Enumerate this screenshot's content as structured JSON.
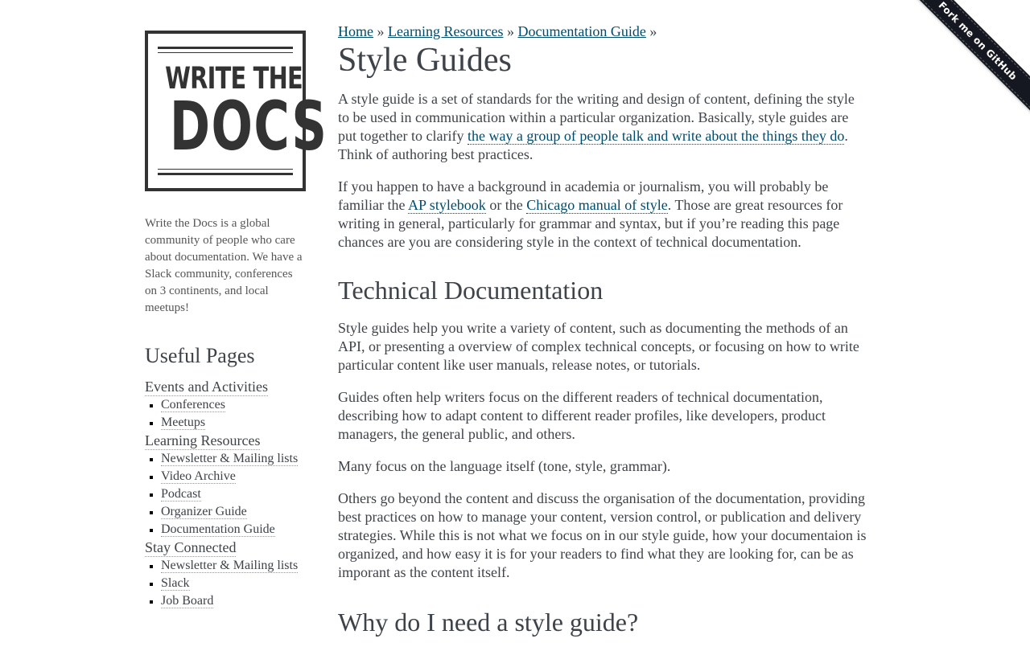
{
  "logo": {
    "line1": "WRITE THE",
    "line2": "DOCS"
  },
  "sidebar": {
    "blurb": "Write the Docs is a global community of people who care about documentation. We have a Slack community, conferences on 3 continents, and local meetups!",
    "useful_title": "Useful Pages",
    "sections": [
      {
        "label": "Events and Activities",
        "items": [
          "Conferences",
          "Meetups"
        ]
      },
      {
        "label": "Learning Resources",
        "items": [
          "Newsletter & Mailing lists",
          "Video Archive",
          "Podcast",
          "Organizer Guide",
          "Documentation Guide"
        ]
      },
      {
        "label": "Stay Connected",
        "items": [
          "Newsletter & Mailing lists",
          "Slack",
          "Job Board"
        ]
      }
    ]
  },
  "breadcrumb": {
    "items": [
      "Home",
      "Learning Resources",
      "Documentation Guide"
    ],
    "separator": "»"
  },
  "main": {
    "title": "Style Guides",
    "intro": {
      "p1_before": "A style guide is a set of standards for the writing and design of content, defining the style to be used in communication within a particular organization. Basically, style guides are put together to clarify ",
      "p1_link": "the way a group of people talk and write about the things they do",
      "p1_after": ". Think of authoring best practices.",
      "p2_before": "If you happen to have a background in academia or journalism, you will probably be familiar the ",
      "p2_link1": "AP stylebook",
      "p2_mid": " or the ",
      "p2_link2": "Chicago manual of style",
      "p2_after": ". Those are great resources for writing in general, particularly for grammar and syntax, but if you’re reading this page chances are you are considering style in the context of technical documentation."
    },
    "section1": {
      "heading": "Technical Documentation",
      "paragraphs": [
        "Style guides help you write a variety of content, such as documenting the methods of an API, or presenting a overview of complex technical concepts, or focusing on how to write particular content like user manuals, release notes, or tutorials.",
        "Guides often help writers focus on the different readers of technical documentation, describing how to adapt content to different reader profiles, like developers, product managers, the general public, and others.",
        "Many focus on the language itself (tone, style, grammar).",
        "Others go beyond the content and discuss the organisation of the documentation, providing best practices on how to manage your content, version control, or publication and delivery strategies. While this is not what we focus on in our style guide, how your documentaion is organized, and how easy it is for your readers to find what they are looking for, can be as imporant as the content itself."
      ]
    },
    "section2": {
      "heading": "Why do I need a style guide?"
    }
  },
  "ribbon": {
    "label": "Fork me on GitHub"
  },
  "colors": {
    "text": "#3e4349",
    "link": "#004b6b",
    "ribbon": "#151820"
  }
}
